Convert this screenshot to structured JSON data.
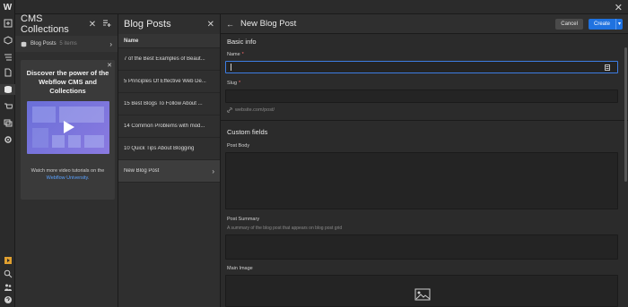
{
  "app": {
    "logo": "W",
    "close": "✕"
  },
  "rail": {
    "icons": [
      "add-icon",
      "box-icon",
      "navigator-icon",
      "pages-icon",
      "cms-icon",
      "ecommerce-icon",
      "assets-icon",
      "settings-icon"
    ],
    "bottom_icons": [
      "tutorials-icon",
      "search-icon",
      "users-icon",
      "help-icon"
    ]
  },
  "collections": {
    "title": "CMS Collections",
    "items": [
      {
        "label": "Blog Posts",
        "count": "5 items"
      }
    ]
  },
  "promo": {
    "title": "Discover the power of the Webflow CMS and Collections",
    "footer_text": "Watch more video tutorials on the",
    "footer_link": "Webflow University."
  },
  "posts": {
    "title": "Blog Posts",
    "column_header": "Name",
    "rows": [
      "7 of the Best Examples of Beaut...",
      "5 Principles Of Effective Web De...",
      "15 Best Blogs To Follow About ...",
      "14 Common Problems with mod...",
      "10 Quick Tips About Blogging",
      "New Blog Post"
    ]
  },
  "editor": {
    "title": "New Blog Post",
    "cancel": "Cancel",
    "create": "Create",
    "basic_info": "Basic info",
    "name_label": "Name",
    "slug_label": "Slug",
    "slug_url": "website.com/post/",
    "custom_fields": "Custom fields",
    "post_body_label": "Post Body",
    "post_summary_label": "Post Summary",
    "post_summary_hint": "A summary of the blog post that appears on blog post grid",
    "main_image_label": "Main Image"
  }
}
